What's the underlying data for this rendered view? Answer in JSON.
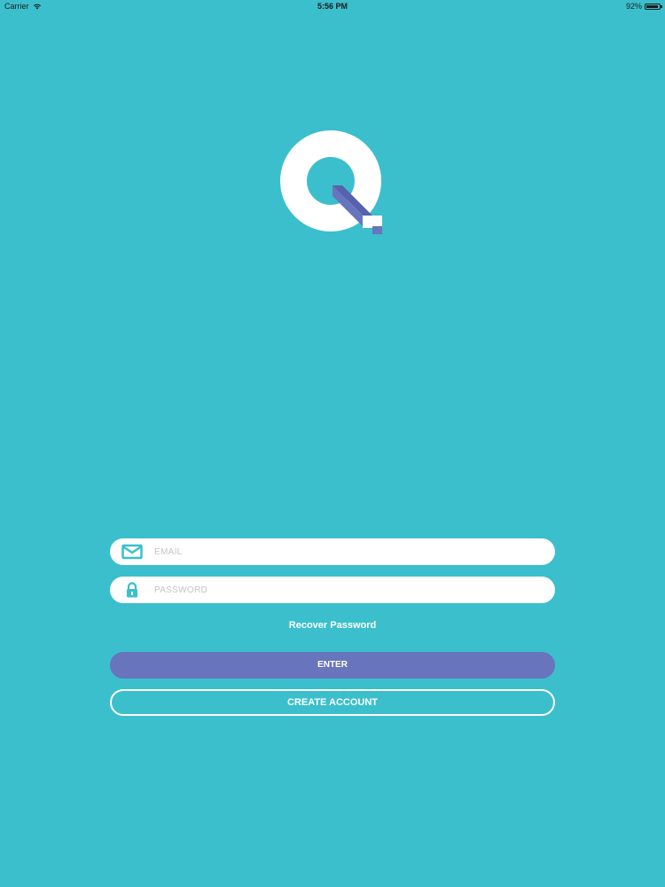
{
  "status_bar": {
    "carrier": "Carrier",
    "time": "5:56 PM",
    "battery_text": "92%",
    "battery_level": 0.92
  },
  "logo": {
    "icon": "q-logo-icon",
    "colors": {
      "ring": "#ffffff",
      "bar_front": "#ffffff",
      "bar_side": "#6874bc",
      "bar_top": "#5662ad"
    }
  },
  "login_form": {
    "email": {
      "icon": "envelope-icon",
      "placeholder": "EMAIL",
      "value": ""
    },
    "password": {
      "icon": "lock-icon",
      "placeholder": "PASSWORD",
      "value": ""
    },
    "recover_label": "Recover Password",
    "enter_label": "ENTER",
    "create_account_label": "CREATE ACCOUNT"
  },
  "colors": {
    "background": "#3bbfcc",
    "accent": "#6874bc",
    "field_icon": "#3bbfcc"
  }
}
